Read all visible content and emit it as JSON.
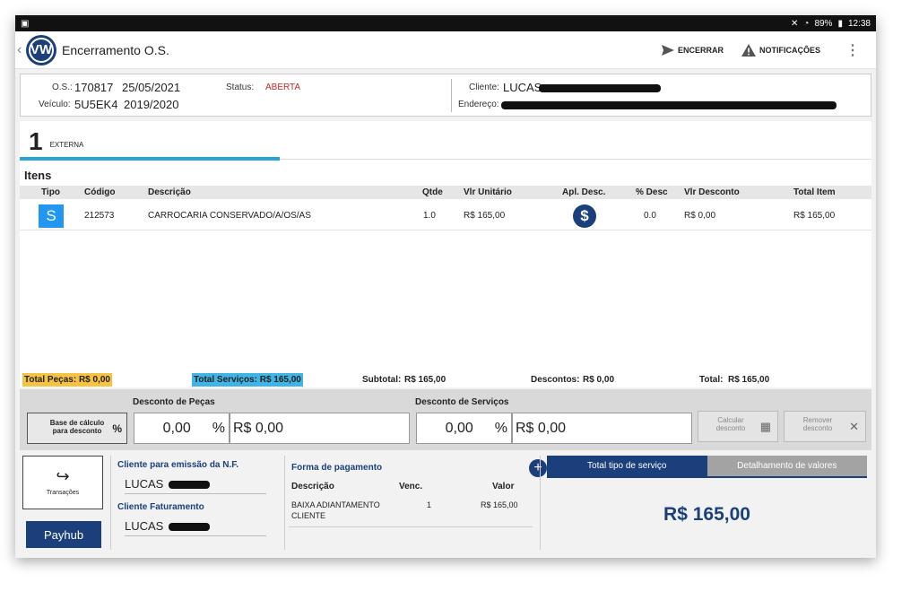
{
  "statusbar": {
    "battery": "89%",
    "time": "12:38"
  },
  "appbar": {
    "title": "Encerramento O.S.",
    "logo_text": "VW",
    "encerrar_label": "ENCERRAR",
    "notificacoes_label": "NOTIFICAÇÕES"
  },
  "header": {
    "os_label": "O.S.:",
    "os_number": "170817",
    "os_date": "25/05/2021",
    "status_label": "Status:",
    "status_value": "ABERTA",
    "veiculo_label": "Veículo:",
    "placa": "5U5EK4",
    "ano": "2019/2020",
    "cliente_label": "Cliente:",
    "cliente_value": "LUCAS",
    "endereco_label": "Endereço:"
  },
  "tab": {
    "number": "1",
    "label": "EXTERNA"
  },
  "items": {
    "title": "Itens",
    "columns": [
      "Tipo",
      "Código",
      "Descrição",
      "Qtde",
      "Vlr Unitário",
      "Apl. Desc.",
      "% Desc",
      "Vlr Desconto",
      "Total Item"
    ],
    "rows": [
      {
        "tipo": "S",
        "codigo": "212573",
        "descricao": "CARROCARIA CONSERVADO/A/OS/AS",
        "qtde": "1.0",
        "vlr_unitario": "R$ 165,00",
        "pct_desc": "0.0",
        "vlr_desconto": "R$ 0,00",
        "total_item": "R$ 165,00"
      }
    ]
  },
  "totals": {
    "pecas": "Total Peças:  R$ 0,00",
    "servicos": "Total Serviços:  R$ 165,00",
    "subtotal_label": "Subtotal:",
    "subtotal_value": "R$ 165,00",
    "descontos_label": "Descontos:",
    "descontos_value": "R$ 0,00",
    "total_label": "Total:",
    "total_value": "R$ 165,00"
  },
  "discounts": {
    "base_line1": "Base de cálculo",
    "base_line2": "para desconto",
    "pecas_label": "Desconto de Peças",
    "pecas_pct": "0,00",
    "pecas_value": "R$ 0,00",
    "servicos_label": "Desconto de Serviços",
    "servicos_pct": "0,00",
    "servicos_value": "R$ 0,00",
    "pct_symbol": "%",
    "calcular_line1": "Calcular",
    "calcular_line2": "desconto",
    "remover_line1": "Remover",
    "remover_line2": "desconto"
  },
  "bottom": {
    "transacoes_label": "Transações",
    "payhub_label": "Payhub",
    "cliente_nf_label": "Cliente para emissão da N.F.",
    "cliente_nf_value": "LUCAS",
    "cliente_fat_label": "Cliente Faturamento",
    "cliente_fat_value": "LUCAS",
    "forma_pagamento_label": "Forma de pagamento",
    "fp_col_descricao": "Descrição",
    "fp_col_venc": "Venc.",
    "fp_col_valor": "Valor",
    "fp_row_desc_line1": "BAIXA ADIANTAMENTO",
    "fp_row_desc_line2": "CLIENTE",
    "fp_row_venc": "1",
    "fp_row_valor": "R$ 165,00",
    "tab_total_tipo": "Total tipo de serviço",
    "tab_detalhamento": "Detalhamento de valores",
    "grand_total": "R$ 165,00"
  },
  "colors": {
    "primary": "#1b3f7a",
    "accent": "#29a3d8",
    "status_red": "#c62828",
    "highlight_yellow": "#f5c242",
    "highlight_blue": "#3fb4e5"
  }
}
